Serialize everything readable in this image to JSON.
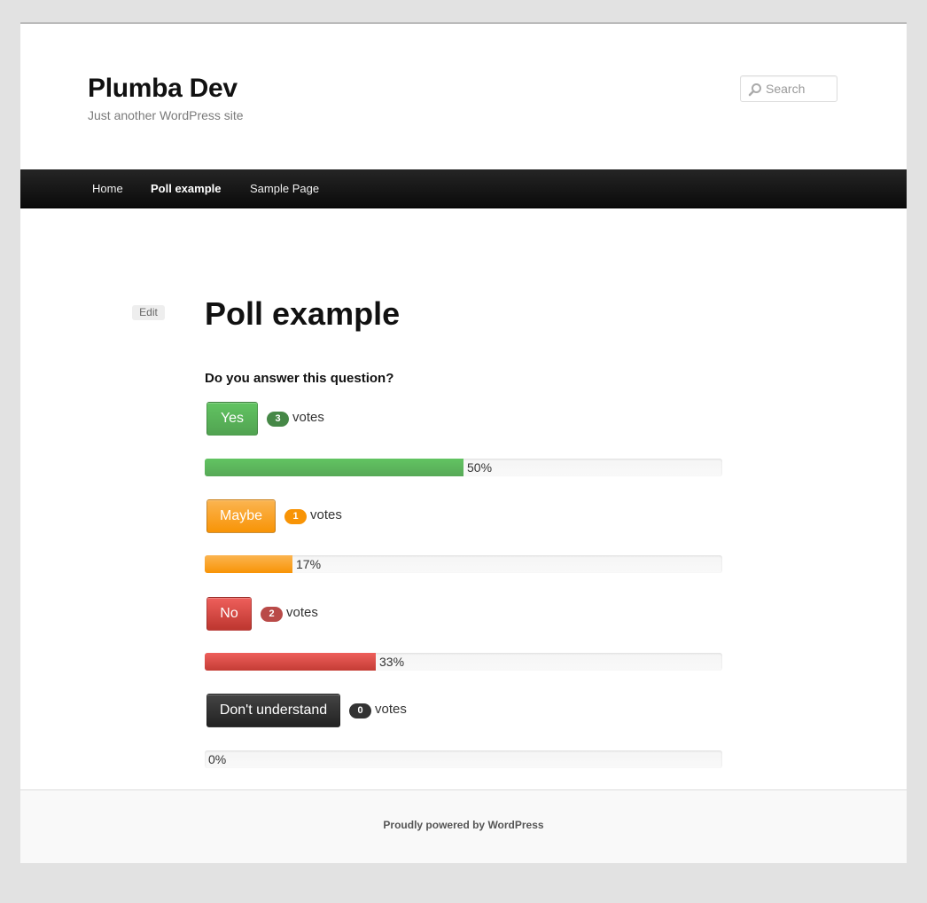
{
  "site": {
    "title": "Plumba Dev",
    "description": "Just another WordPress site"
  },
  "search": {
    "placeholder": "Search"
  },
  "nav": {
    "items": [
      {
        "label": "Home"
      },
      {
        "label": "Poll example",
        "current": true
      },
      {
        "label": "Sample Page"
      }
    ]
  },
  "entry": {
    "edit_label": "Edit",
    "title": "Poll example"
  },
  "poll": {
    "question": "Do you answer this question?",
    "votes_label": "votes",
    "options": [
      {
        "label": "Yes",
        "votes": "3",
        "percent": "50%",
        "fraction": 0.5,
        "color": "#5bb75b"
      },
      {
        "label": "Maybe",
        "votes": "1",
        "percent": "17%",
        "fraction": 0.17,
        "color": "#faa732"
      },
      {
        "label": "No",
        "votes": "2",
        "percent": "33%",
        "fraction": 0.33,
        "color": "#da4f49"
      },
      {
        "label": "Don't understand",
        "votes": "0",
        "percent": "0%",
        "fraction": 0,
        "color": "#363636"
      }
    ]
  },
  "footer": {
    "text": "Proudly powered by WordPress"
  }
}
